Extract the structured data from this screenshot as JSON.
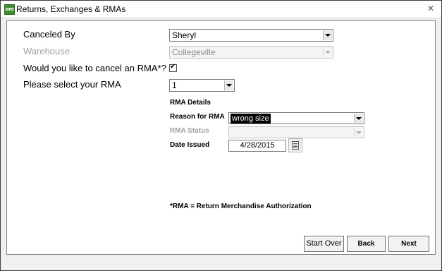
{
  "window": {
    "title": "Returns, Exchanges & RMAs",
    "app_icon_text": "om",
    "close_glyph": "✕"
  },
  "form": {
    "canceled_by": {
      "label": "Canceled By",
      "value": "Sheryl"
    },
    "warehouse": {
      "label": "Warehouse",
      "value": "Collegeville"
    },
    "cancel_rma": {
      "label": "Would you like to cancel an RMA*?",
      "checked": true,
      "check_glyph": "✔"
    },
    "select_rma": {
      "label": "Please select your RMA",
      "value": "1"
    }
  },
  "rma_details": {
    "heading": "RMA Details",
    "reason": {
      "label": "Reason for RMA",
      "value": "wrong size"
    },
    "status": {
      "label": "RMA Status",
      "value": ""
    },
    "date_issued": {
      "label": "Date Issued",
      "value": "4/28/2015"
    }
  },
  "footnote": "*RMA = Return Merchandise Authorization",
  "buttons": {
    "start_over": "Start Over",
    "back": "Back",
    "next": "Next"
  }
}
